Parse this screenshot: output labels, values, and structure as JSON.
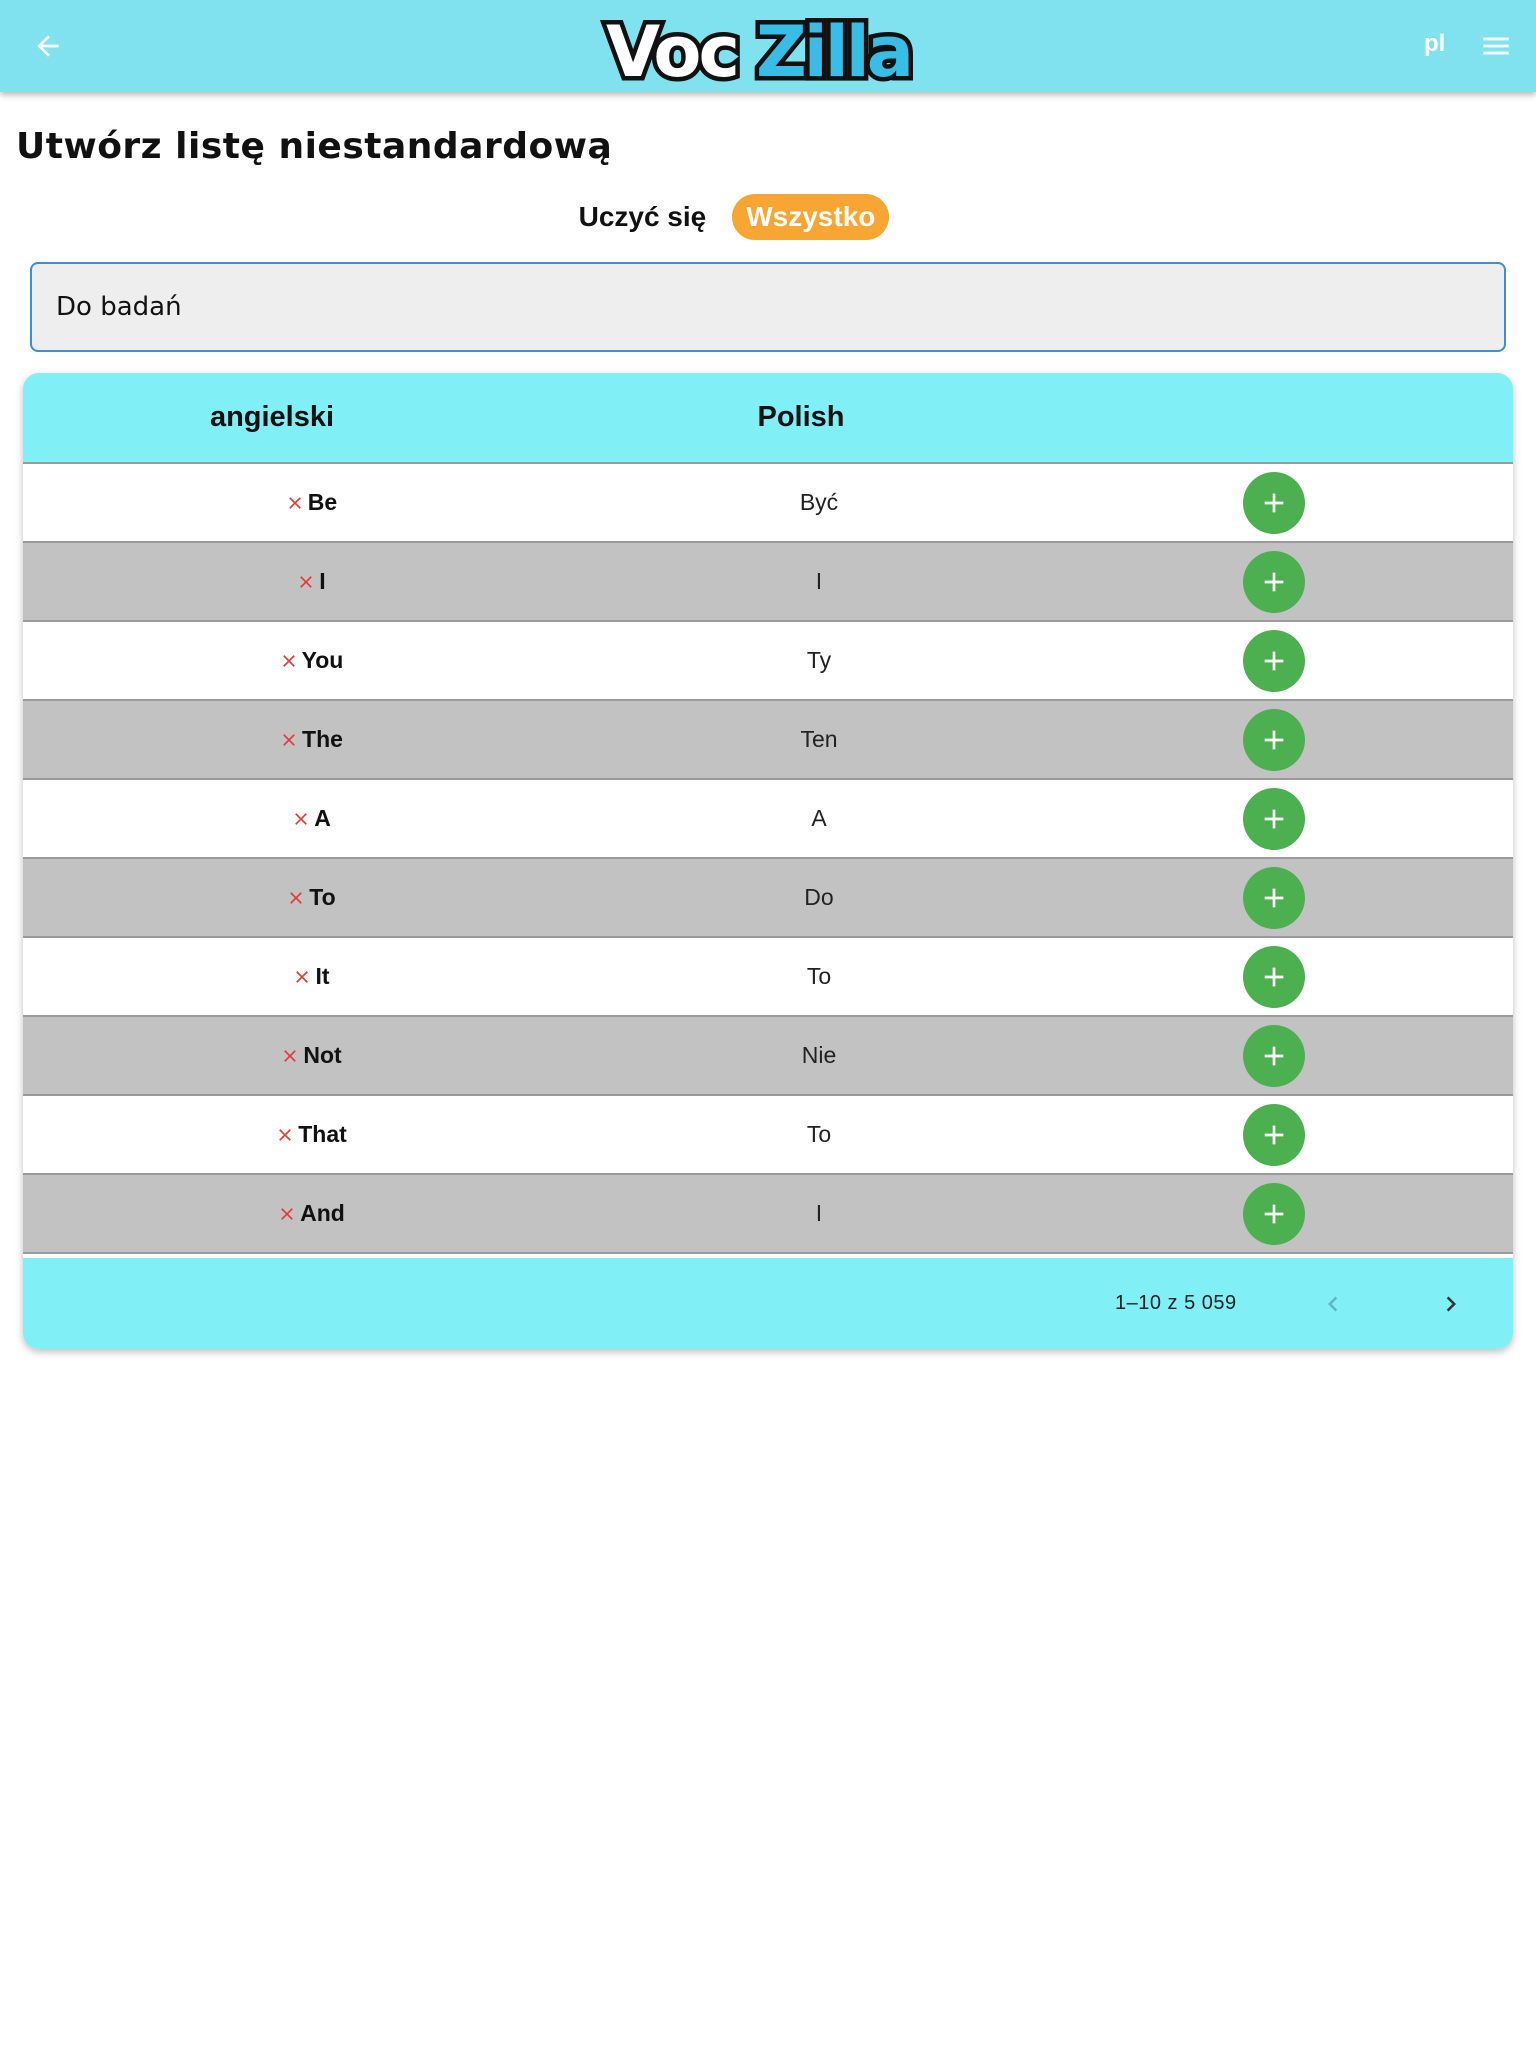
{
  "header": {
    "logo_text_part1": "Voc",
    "logo_text_part2": "Zilla",
    "language": "pl"
  },
  "page": {
    "title": "Utwórz listę niestandardową"
  },
  "mode_toggle": {
    "learn_label": "Uczyć się",
    "all_label": "Wszystko",
    "selected": "Wszystko"
  },
  "list_name": {
    "value": "Do badań"
  },
  "table": {
    "columns": [
      "angielski",
      "Polish"
    ],
    "rows": [
      {
        "en": "Be",
        "pl": "Być"
      },
      {
        "en": "I",
        "pl": "I"
      },
      {
        "en": "You",
        "pl": "Ty"
      },
      {
        "en": "The",
        "pl": "Ten"
      },
      {
        "en": "A",
        "pl": "A"
      },
      {
        "en": "To",
        "pl": "Do"
      },
      {
        "en": "It",
        "pl": "To"
      },
      {
        "en": "Not",
        "pl": "Nie"
      },
      {
        "en": "That",
        "pl": "To"
      },
      {
        "en": "And",
        "pl": "I"
      }
    ],
    "pagination": "1–10 z 5 059"
  },
  "colors": {
    "appbar": "#80e2ee",
    "table_header": "#80eff6",
    "accent_orange": "#f7a533",
    "add_green": "#4caf50",
    "remove_red": "#e53935",
    "row_alt": "#c2c2c2"
  }
}
